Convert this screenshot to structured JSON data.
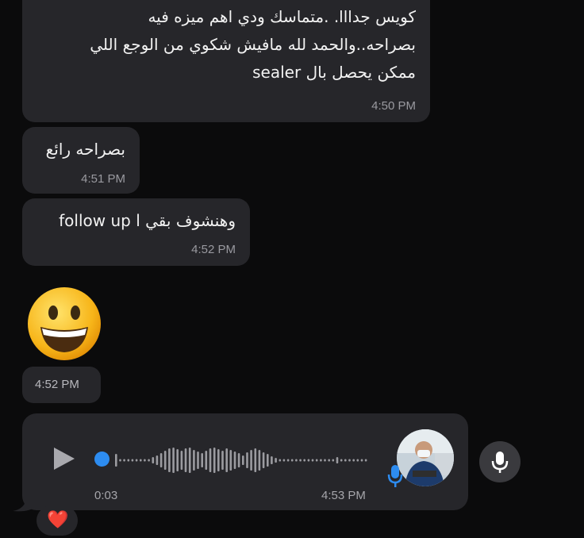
{
  "messages": [
    {
      "lines": [
        "كويس جدااا. .متماسك ودي اهم ميزه فيه",
        "بصراحه..والحمد لله مافيش شكوي من الوجع اللي",
        "ممكن يحصل بال sealer"
      ],
      "time": "4:50 PM"
    },
    {
      "text": "بصراحه رائع",
      "time": "4:51 PM"
    },
    {
      "text": "وهنشوف بقي follow up l",
      "time": "4:52 PM"
    },
    {
      "emoji": "grinning-face",
      "time": "4:52 PM"
    }
  ],
  "voice": {
    "elapsed": "0:03",
    "time": "4:53 PM"
  },
  "reaction": "❤️",
  "colors": {
    "bubble": "#26262a",
    "background": "#0b0b0c",
    "accent": "#2d8cf0",
    "time": "#9a9aa0"
  }
}
